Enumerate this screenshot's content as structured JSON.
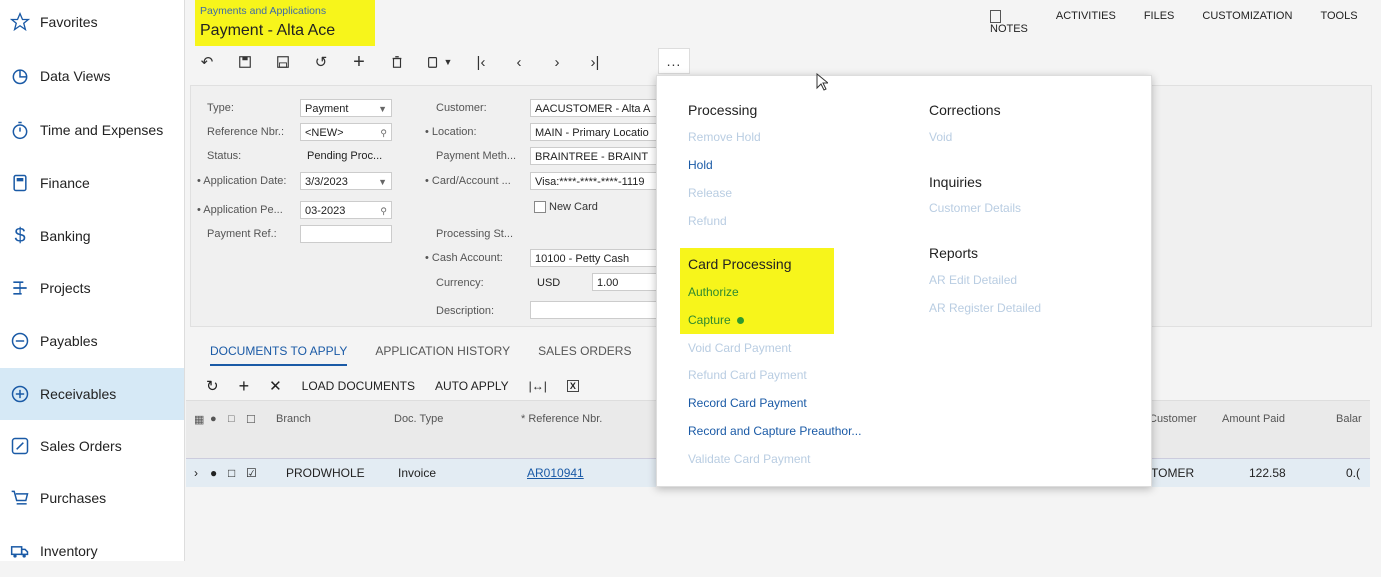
{
  "sidebar": {
    "items": [
      {
        "label": "Favorites",
        "icon": "star-icon"
      },
      {
        "label": "Data Views",
        "icon": "pie-chart-icon"
      },
      {
        "label": "Time and Expenses",
        "icon": "stopwatch-icon"
      },
      {
        "label": "Finance",
        "icon": "calculator-icon"
      },
      {
        "label": "Banking",
        "icon": "dollar-icon"
      },
      {
        "label": "Projects",
        "icon": "projects-icon"
      },
      {
        "label": "Payables",
        "icon": "minus-circle-icon"
      },
      {
        "label": "Receivables",
        "icon": "plus-circle-icon"
      },
      {
        "label": "Sales Orders",
        "icon": "edit-icon"
      },
      {
        "label": "Purchases",
        "icon": "cart-icon"
      },
      {
        "label": "Inventory",
        "icon": "truck-icon"
      }
    ]
  },
  "header": {
    "subtitle": "Payments and Applications",
    "title": "Payment - Alta Ace",
    "links": [
      "NOTES",
      "ACTIVITIES",
      "FILES",
      "CUSTOMIZATION",
      "TOOLS"
    ],
    "more": "..."
  },
  "form": {
    "type_label": "Type:",
    "type_value": "Payment",
    "ref_label": "Reference Nbr.:",
    "ref_value": "<NEW>",
    "status_label": "Status:",
    "status_value": "Pending Proc...",
    "appdate_label": "• Application Date:",
    "appdate_value": "3/3/2023",
    "apppe_label": "• Application Pe...",
    "apppe_value": "03-2023",
    "payref_label": "Payment Ref.:",
    "customer_label": "Customer:",
    "customer_value": "AACUSTOMER - Alta A",
    "location_label": "• Location:",
    "location_value": "MAIN - Primary Locatio",
    "paymeth_label": "Payment Meth...",
    "paymeth_value": "BRAINTREE - BRAINT",
    "card_label": "• Card/Account ...",
    "card_value": "Visa:****-****-****-1119",
    "newcard_label": "New Card",
    "procst_label": "Processing St...",
    "cash_label": "• Cash Account:",
    "cash_value": "10100 - Petty Cash",
    "currency_label": "Currency:",
    "currency_value": "USD",
    "rate_value": "1.00",
    "desc_label": "Description:"
  },
  "tabs": [
    "DOCUMENTS TO APPLY",
    "APPLICATION HISTORY",
    "SALES ORDERS"
  ],
  "grid_toolbar": {
    "load": "LOAD DOCUMENTS",
    "auto": "AUTO APPLY"
  },
  "grid": {
    "headers": {
      "branch": "Branch",
      "doctype": "Doc. Type",
      "refnbr": "* Reference Nbr.",
      "customer": "Customer",
      "amount": "Amount Paid",
      "balance": "Balar"
    },
    "row": {
      "branch": "PRODWHOLE",
      "doctype": "Invoice",
      "refnbr": "AR010941",
      "customer": "TOMER",
      "amount": "122.58",
      "balance": "0.("
    }
  },
  "menu": {
    "processing": {
      "head": "Processing",
      "items": [
        "Remove Hold",
        "Hold",
        "Release",
        "Refund"
      ]
    },
    "card": {
      "head": "Card Processing",
      "items": [
        "Authorize",
        "Capture"
      ]
    },
    "card_more": [
      "Void Card Payment",
      "Refund Card Payment",
      "Record Card Payment",
      "Record and Capture Preauthor...",
      "Validate Card Payment"
    ],
    "corrections": {
      "head": "Corrections",
      "items": [
        "Void"
      ]
    },
    "inquiries": {
      "head": "Inquiries",
      "items": [
        "Customer Details"
      ]
    },
    "reports": {
      "head": "Reports",
      "items": [
        "AR Edit Detailed",
        "AR Register Detailed"
      ]
    }
  },
  "colors": {
    "highlight": "#f7f51b",
    "link": "#1a5aa6",
    "disabled": "#b9cde2",
    "green": "#2f8a2f",
    "active_sidebar": "#d6e9f6"
  }
}
